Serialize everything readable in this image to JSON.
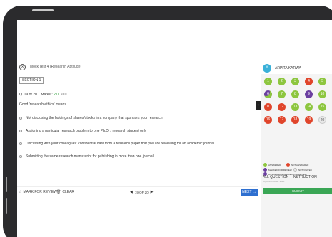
{
  "header": {
    "test_title": "Mock Test 4 (Research Aptitude)",
    "section_label": "SECTION 1"
  },
  "question": {
    "position_prefix": "Q. 19 of 20",
    "marks_label": "Marks :",
    "marks_positive": "2.0,",
    "marks_negative": "-0.0",
    "text": "Good 'research ethics' means",
    "options": [
      "Not disclosing the holdings of shares/stocks in a company that sponsors your research",
      "Assigning a particular research problem to one Ph.D. / research student only",
      "Discussing with your colleagues' confidential data from a research paper that you are reviewing for an academic journal",
      "Submitting the same research manuscript for publishing in more than one journal"
    ]
  },
  "footer": {
    "mark_review_label": "MARK FOR REVIEW",
    "clear_label": "CLEAR",
    "pager_text": "19 OF 20",
    "next_label": "NEXT"
  },
  "sidebar": {
    "avatar_letter": "A",
    "username": "ARPITA KARWA",
    "questions": [
      {
        "n": "1",
        "status": "answered"
      },
      {
        "n": "2",
        "status": "answered"
      },
      {
        "n": "3",
        "status": "answered"
      },
      {
        "n": "4",
        "status": "not-answered"
      },
      {
        "n": "5",
        "status": "answered"
      },
      {
        "n": "6",
        "status": "answered-marked"
      },
      {
        "n": "7",
        "status": "answered"
      },
      {
        "n": "8",
        "status": "answered"
      },
      {
        "n": "9",
        "status": "marked"
      },
      {
        "n": "10",
        "status": "answered"
      },
      {
        "n": "11",
        "status": "not-answered"
      },
      {
        "n": "12",
        "status": "not-answered"
      },
      {
        "n": "13",
        "status": "answered"
      },
      {
        "n": "14",
        "status": "answered"
      },
      {
        "n": "15",
        "status": "answered"
      },
      {
        "n": "16",
        "status": "not-answered"
      },
      {
        "n": "17",
        "status": "not-answered"
      },
      {
        "n": "18",
        "status": "not-answered"
      },
      {
        "n": "19",
        "status": "not-answered"
      },
      {
        "n": "20",
        "status": "not-visited"
      }
    ],
    "legend": {
      "answered": "ANSWERED",
      "not_answered": "NOT ANSWERED",
      "marked": "MARKED FOR REVIEW",
      "not_visited": "NOT VISITED",
      "answered_marked": "ANSWERED & MARKED FOR REVIEW"
    },
    "tab_all_question": "ALL QUESTION",
    "tab_instruction": "INSTRUCTION",
    "copyright": "(C) COPYRIGHT 2020",
    "submit_label": "SUBMIT"
  },
  "colors": {
    "answered": "#8dc63f",
    "not_answered": "#e0452b",
    "marked": "#6b3fa0",
    "not_visited": "#e8e8e8",
    "next_button": "#2e6fd0",
    "submit_button": "#3aa655",
    "avatar": "#3ab0d8"
  },
  "icons": {
    "close": "close-circle-icon",
    "mark_review": "star-icon",
    "clear": "trash-icon",
    "pager_prev": "triangle-left-icon",
    "pager_next": "triangle-right-icon",
    "next": "arrow-right-icon",
    "collapse": "chevron-right-icon"
  }
}
